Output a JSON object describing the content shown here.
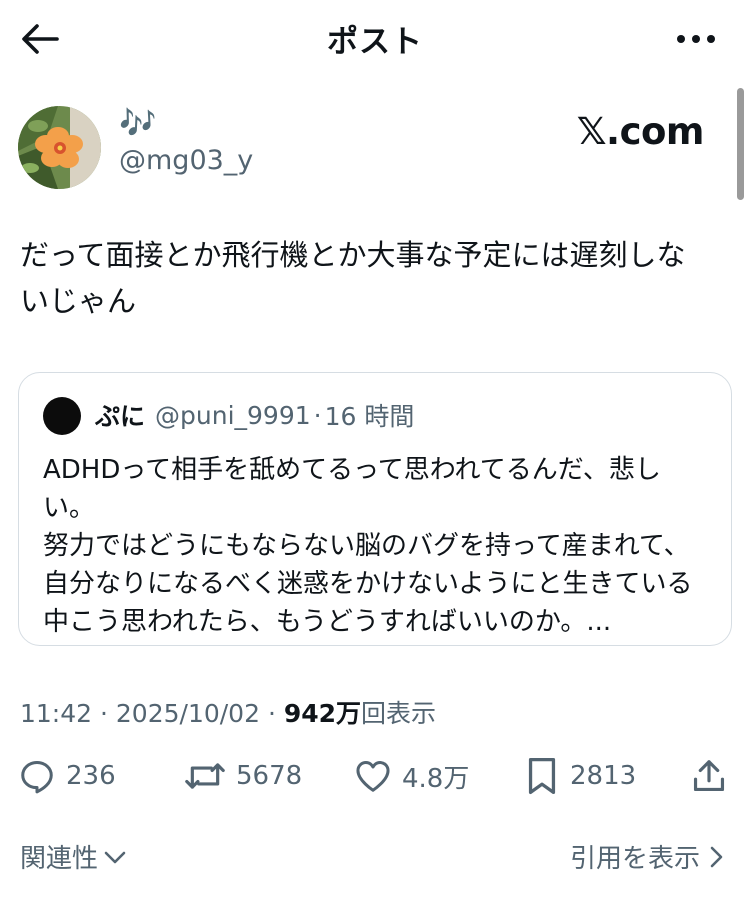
{
  "header": {
    "title": "ポスト"
  },
  "author": {
    "display_name": "🎶",
    "handle": "@mg03_y"
  },
  "brand": {
    "label": "𝕏.com"
  },
  "post": {
    "text_lines": [
      "だって面接とか飛行機とか大事な予定には遅刻しな",
      "いじゃん"
    ]
  },
  "quote": {
    "name": "ぷに",
    "handle": "@puni_9991",
    "dot": "·",
    "time": "16 時間",
    "lines": [
      "ADHDって相手を舐めてるって思われてるんだ、悲し",
      "い。",
      "努力ではどうにもならない脳のバグを持って産まれて、",
      "自分なりになるべく迷惑をかけないようにと生きている",
      "中こう思われたら、もうどうすればいいのか。..."
    ]
  },
  "meta": {
    "time": "11:42",
    "sep1": "·",
    "date": "2025/10/02",
    "sep2": "·",
    "views": "942万",
    "views_label": "回表示"
  },
  "actions": {
    "replies": "236",
    "reposts": "5678",
    "likes": "4.8万",
    "bookmarks": "2813"
  },
  "footer": {
    "related": "関連性",
    "view_quotes": "引用を表示"
  },
  "icons": {
    "back": "arrow-left-icon",
    "more": "more-dots-icon",
    "reply": "reply-icon",
    "repost": "repost-icon",
    "like": "heart-icon",
    "bookmark": "bookmark-icon",
    "share": "share-icon"
  },
  "colors": {
    "text": "#0f1419",
    "secondary": "#536471",
    "border": "#d6dde3"
  }
}
